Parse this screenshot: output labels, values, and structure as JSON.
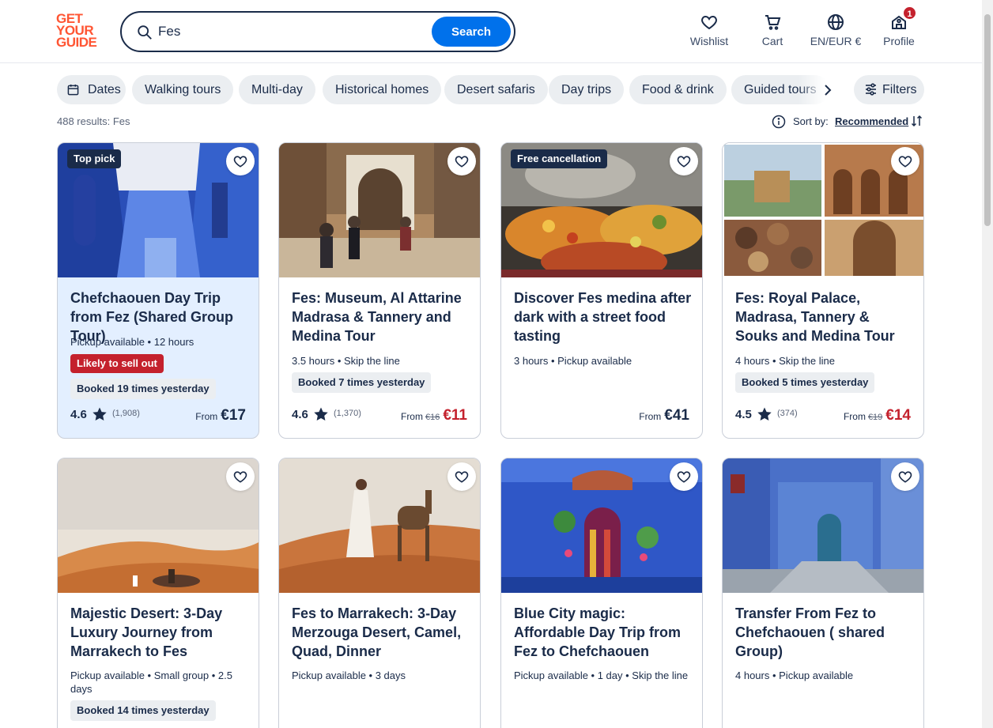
{
  "logo": {
    "line1": "GET",
    "line2": "YOUR",
    "line3": "GUIDE"
  },
  "search": {
    "value": "Fes",
    "button": "Search"
  },
  "nav": {
    "wishlist": "Wishlist",
    "cart": "Cart",
    "currency": "EN/EUR €",
    "profile": "Profile",
    "profile_badge": "1"
  },
  "chips": [
    "Dates",
    "Walking tours",
    "Multi-day",
    "Historical homes",
    "Desert safaris",
    "Day trips",
    "Food & drink",
    "Guided tours"
  ],
  "filters_label": "Filters",
  "results_text": "488 results: Fes",
  "sort": {
    "label": "Sort by:",
    "value": "Recommended"
  },
  "colors": {
    "accent": "#0071eb",
    "brand": "#ff5533",
    "sale": "#c4212d",
    "navy": "#1a2b49"
  },
  "cards": [
    {
      "tag": "Top pick",
      "title": "Chefchaouen Day Trip from Fez (Shared Group Tour)",
      "meta": "Pickup available • 12 hours",
      "urgency": "Likely to sell out",
      "booked": "Booked 19 times yesterday",
      "rating": "4.6",
      "reviews": "(1,908)",
      "from": "From",
      "price": "€17"
    },
    {
      "title": "Fes: Museum, Al Attarine Madrasa & Tannery and Medina Tour",
      "meta": "3.5 hours • Skip the line",
      "booked": "Booked 7 times yesterday",
      "rating": "4.6",
      "reviews": "(1,370)",
      "from": "From",
      "old_price": "€16",
      "price": "€11"
    },
    {
      "tag": "Free cancellation",
      "title": "Discover Fes medina after dark with a street food tasting",
      "meta": "3 hours • Pickup available",
      "from": "From",
      "price": "€41"
    },
    {
      "title": "Fes: Royal Palace, Madrasa, Tannery & Souks and Medina Tour",
      "meta": "4 hours • Skip the line",
      "booked": "Booked 5 times yesterday",
      "rating": "4.5",
      "reviews": "(374)",
      "from": "From",
      "old_price": "€19",
      "price": "€14"
    },
    {
      "title": "Majestic Desert: 3-Day Luxury Journey from Marrakech to Fes",
      "meta": "Pickup available • Small group • 2.5 days",
      "booked": "Booked 14 times yesterday"
    },
    {
      "title": "Fes to Marrakech: 3-Day Merzouga Desert, Camel, Quad, Dinner",
      "meta": "Pickup available • 3 days"
    },
    {
      "title": "Blue City magic: Affordable Day Trip from Fez to Chefchaouen",
      "meta": "Pickup available • 1 day • Skip the line"
    },
    {
      "title": "Transfer From Fez to Chefchaouen ( shared Group)",
      "meta": "4 hours • Pickup available"
    }
  ]
}
